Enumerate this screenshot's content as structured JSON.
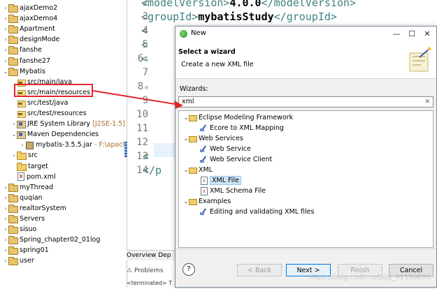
{
  "tree": {
    "items": [
      {
        "label": "ajaxDemo2",
        "icon": "project-icon",
        "expanded": false,
        "indent": 0
      },
      {
        "label": "ajaxDemo4",
        "icon": "project-icon",
        "expanded": false,
        "indent": 0
      },
      {
        "label": "Apartment",
        "icon": "project-icon",
        "expanded": false,
        "indent": 0
      },
      {
        "label": "designMode",
        "icon": "project-icon",
        "expanded": false,
        "indent": 0
      },
      {
        "label": "fanshe",
        "icon": "project-icon",
        "expanded": false,
        "indent": 0
      },
      {
        "label": "fanshe27",
        "icon": "project-icon",
        "expanded": false,
        "indent": 0
      },
      {
        "label": "Mybatis",
        "icon": "project-icon",
        "expanded": true,
        "indent": 0
      },
      {
        "label": "src/main/java",
        "icon": "source-folder-icon",
        "indent": 1
      },
      {
        "label": "src/main/resources",
        "icon": "source-folder-icon",
        "indent": 1
      },
      {
        "label": "src/test/java",
        "icon": "source-folder-icon",
        "indent": 1
      },
      {
        "label": "src/test/resources",
        "icon": "source-folder-icon",
        "indent": 1
      },
      {
        "label": "JRE System Library",
        "decoration": "[J2SE-1.5]",
        "icon": "library-icon",
        "expanded": false,
        "indent": 1
      },
      {
        "label": "Maven Dependencies",
        "icon": "library-icon",
        "expanded": true,
        "indent": 1
      },
      {
        "label": "mybatis-3.5.5.jar",
        "decoration": "- F:\\apach",
        "icon": "jar-icon",
        "expanded": false,
        "indent": 2
      },
      {
        "label": "src",
        "icon": "folder-icon",
        "expanded": false,
        "indent": 1
      },
      {
        "label": "target",
        "icon": "folder-icon",
        "indent": 1
      },
      {
        "label": "pom.xml",
        "icon": "xml-file-icon",
        "indent": 1
      },
      {
        "label": "myThread",
        "icon": "project-icon",
        "expanded": false,
        "indent": 0
      },
      {
        "label": "quqian",
        "icon": "project-icon",
        "expanded": false,
        "indent": 0
      },
      {
        "label": "realtorSystem",
        "icon": "project-icon",
        "expanded": false,
        "indent": 0
      },
      {
        "label": "Servers",
        "icon": "project-icon",
        "expanded": false,
        "indent": 0
      },
      {
        "label": "sisuo",
        "icon": "project-icon",
        "expanded": false,
        "indent": 0
      },
      {
        "label": "Spring_chapter02_01log",
        "icon": "project-icon",
        "expanded": false,
        "indent": 0
      },
      {
        "label": "spring01",
        "icon": "project-icon",
        "expanded": false,
        "indent": 0
      },
      {
        "label": "user",
        "icon": "project-icon",
        "expanded": false,
        "indent": 0
      }
    ]
  },
  "editor": {
    "lines": [
      {
        "num": "2",
        "fold": "",
        "code_tag": "<modelVersion>",
        "code_text": "4.0.0",
        "code_close": "</modelVersion>"
      },
      {
        "num": "3",
        "fold": "",
        "code_tag": "<groupId>",
        "code_text": "mybatisStudy",
        "code_close": "</groupId>"
      },
      {
        "num": "4",
        "fold": "",
        "code_tag": "<",
        "code_text": "",
        "code_close": ""
      },
      {
        "num": "5",
        "fold": "",
        "code_tag": "<",
        "code_text": "",
        "code_close": ""
      },
      {
        "num": "6",
        "fold": "⊖",
        "code_tag": "<",
        "code_text": "",
        "code_close": ""
      },
      {
        "num": "7",
        "fold": "",
        "code_tag": "",
        "code_text": "",
        "code_close": ""
      },
      {
        "num": "8",
        "fold": "⊖",
        "code_tag": "",
        "code_text": "",
        "code_close": ""
      },
      {
        "num": "9",
        "fold": "",
        "code_tag": "",
        "code_text": "",
        "code_close": ""
      },
      {
        "num": "10",
        "fold": "",
        "code_tag": "",
        "code_text": "",
        "code_close": ""
      },
      {
        "num": "11",
        "fold": "",
        "code_tag": "",
        "code_text": "",
        "code_close": ""
      },
      {
        "num": "12",
        "fold": "",
        "code_tag": "",
        "code_text": "",
        "code_close": ""
      },
      {
        "num": "13",
        "fold": "",
        "code_tag": "<",
        "code_text": "",
        "code_close": ""
      },
      {
        "num": "14",
        "fold": "",
        "code_tag": "</p",
        "code_text": "",
        "code_close": ""
      }
    ],
    "bottom_tabs": "Overview  Dep",
    "problems_tab": "Problems",
    "console_text": "<terminated> T"
  },
  "dialog": {
    "title": "New",
    "heading": "Select a wizard",
    "subheading": "Create a new XML file",
    "wizards_label": "Wizards:",
    "filter_value": "xml",
    "tree": [
      {
        "label": "Eclipse Modeling Framework",
        "type": "category",
        "expanded": true
      },
      {
        "label": "Ecore to XML Mapping",
        "type": "wizard",
        "icon": "wizard-icon"
      },
      {
        "label": "Web Services",
        "type": "category",
        "expanded": true
      },
      {
        "label": "Web Service",
        "type": "wizard",
        "icon": "wizard-icon"
      },
      {
        "label": "Web Service Client",
        "type": "wizard",
        "icon": "wizard-icon"
      },
      {
        "label": "XML",
        "type": "category",
        "expanded": true
      },
      {
        "label": "XML File",
        "type": "wizard",
        "icon": "xml-file-icon",
        "selected": true
      },
      {
        "label": "XML Schema File",
        "type": "wizard",
        "icon": "xml-schema-icon"
      },
      {
        "label": "Examples",
        "type": "category",
        "expanded": true
      },
      {
        "label": "Editing and validating XML files",
        "type": "wizard",
        "icon": "wizard-icon"
      }
    ],
    "buttons": {
      "back": "< Back",
      "next": "Next >",
      "finish": "Finish",
      "cancel": "Cancel"
    },
    "help": "?",
    "window_controls": {
      "minimize": "—",
      "maximize": "☐",
      "close": "✕"
    }
  },
  "watermark": "https://blog.csdn.net/qq_41150890",
  "colors": {
    "annotation": "#e0262c",
    "selection": "#cce4f7",
    "xml_tag": "#3f7f7f"
  }
}
